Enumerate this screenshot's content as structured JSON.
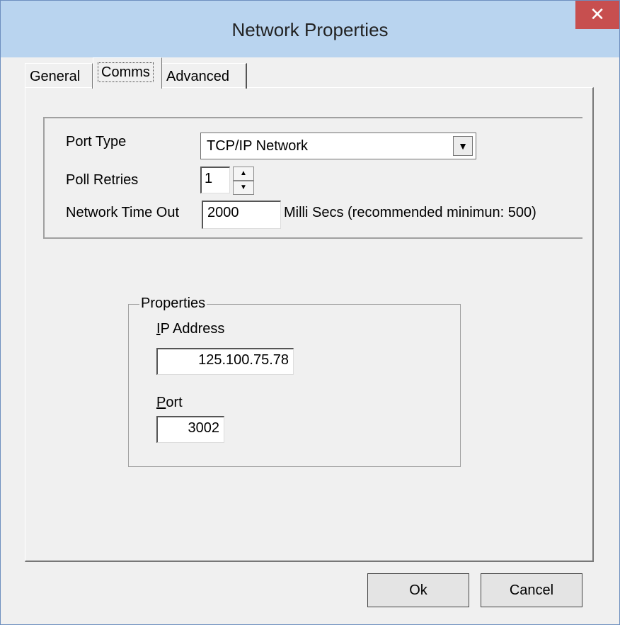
{
  "window": {
    "title": "Network Properties",
    "close_glyph": "✕"
  },
  "tabs": [
    {
      "label": "General"
    },
    {
      "label": "Comms"
    },
    {
      "label": "Advanced"
    }
  ],
  "comms": {
    "port_type_label": "Port Type",
    "port_type_value": "TCP/IP Network",
    "poll_retries_label": "Poll Retries",
    "poll_retries_value": "1",
    "timeout_label": "Network Time Out",
    "timeout_value": "2000",
    "timeout_unit": "Milli Secs (recommended minimun: 500)"
  },
  "properties": {
    "legend": "Properties",
    "ip_label": "IP Address",
    "ip_value": "125.100.75.78",
    "port_label": "Port",
    "port_value": "3002"
  },
  "buttons": {
    "ok": "Ok",
    "cancel": "Cancel"
  }
}
